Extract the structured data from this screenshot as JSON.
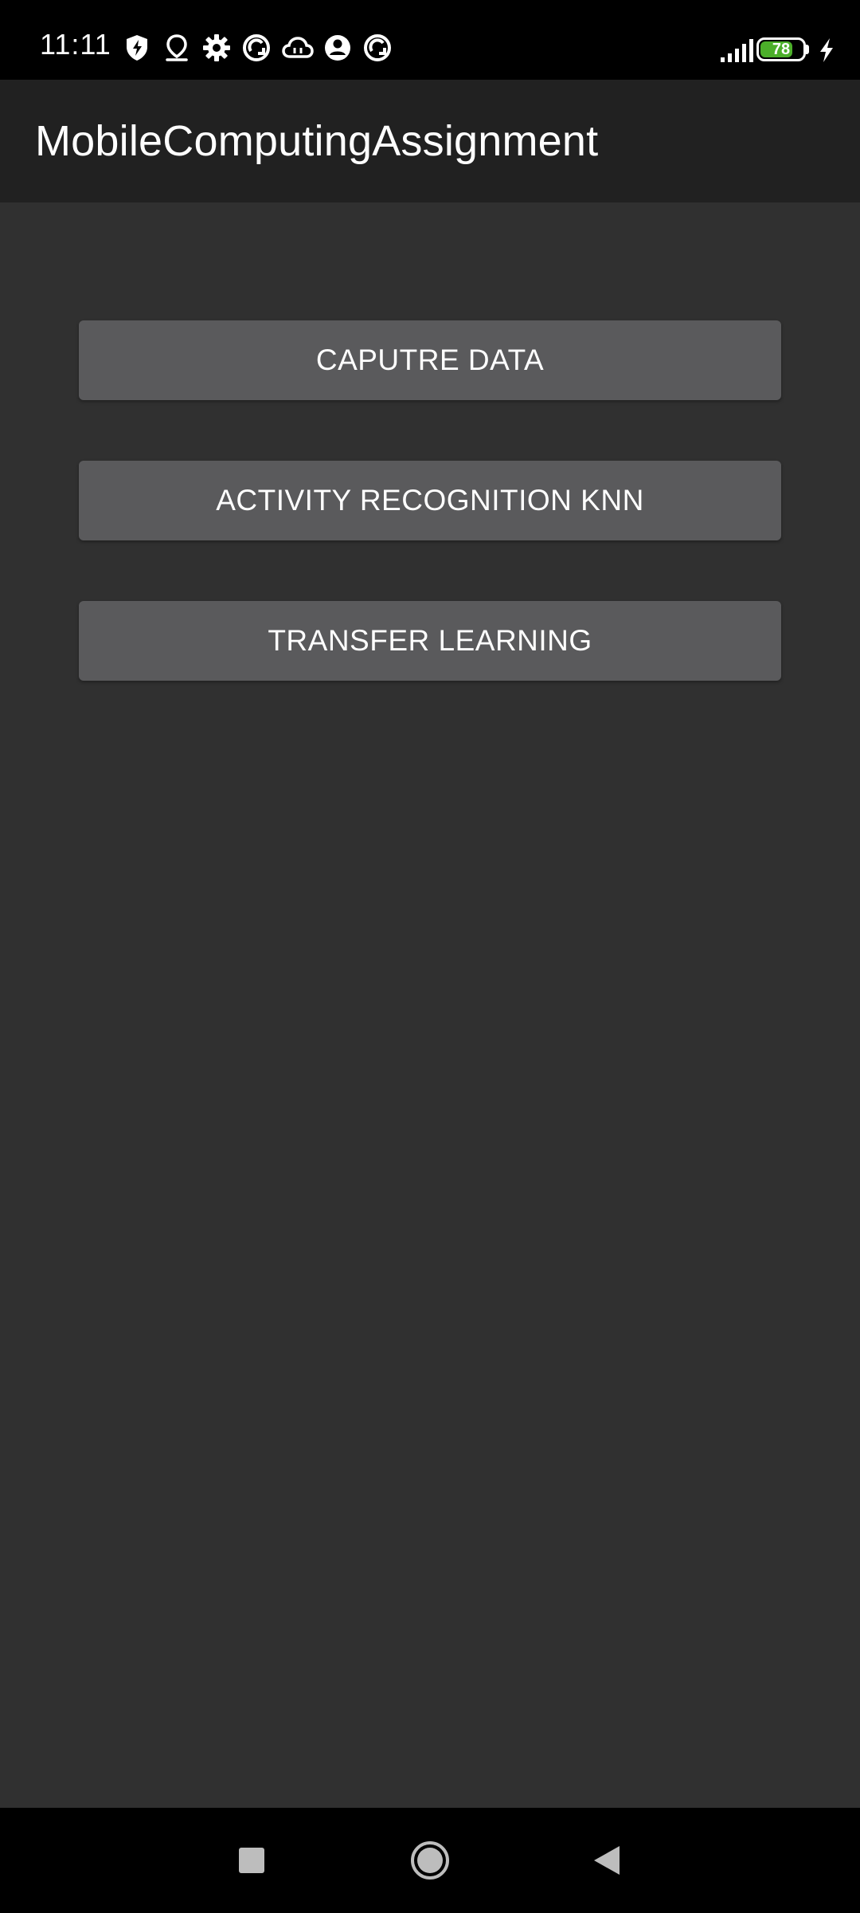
{
  "status_bar": {
    "time": "11:11",
    "battery_level": "78",
    "icons": [
      "shield-icon",
      "location-pin-icon",
      "settings-gear-icon",
      "sync-circle-icon",
      "cloud-icon",
      "account-icon",
      "sync-circle-icon",
      "signal-icon",
      "battery-icon",
      "charging-icon"
    ],
    "battery_color": "#4caf2a"
  },
  "app_bar": {
    "title": "MobileComputingAssignment"
  },
  "main": {
    "buttons": [
      {
        "label": "CAPUTRE DATA"
      },
      {
        "label": "ACTIVITY RECOGNITION KNN"
      },
      {
        "label": "TRANSFER LEARNING"
      }
    ]
  },
  "nav_bar": {
    "icons": [
      "recents-square-icon",
      "home-circle-icon",
      "back-triangle-icon"
    ]
  },
  "colors": {
    "status_bar_bg": "#000000",
    "app_bar_bg": "#212121",
    "content_bg": "#303030",
    "button_bg": "#5a5a5c",
    "text": "#ffffff"
  }
}
